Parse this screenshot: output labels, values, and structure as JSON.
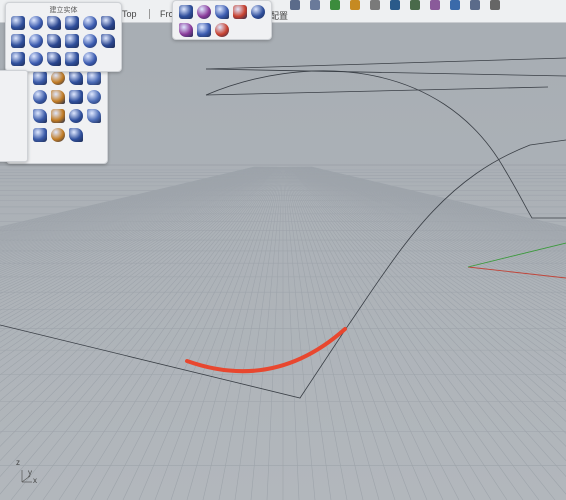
{
  "viewport_tabs": [
    "Top",
    "Fron",
    "配置"
  ],
  "solid_panel": {
    "title": "建立实体"
  },
  "axis_labels": {
    "z": "z",
    "x": "x",
    "y": "y"
  },
  "icons": {
    "solid_panel": [
      "box-icon",
      "cylinder-icon",
      "sphere-icon",
      "ellipsoid-icon",
      "ellipse-solid-icon",
      "cone-icon",
      "cube-icon",
      "pyramid-icon",
      "truncated-cone-icon",
      "cone-small-icon",
      "pyramid-small-icon",
      "tube-icon",
      "pipe-icon",
      "torus-icon",
      "fillet-solid-icon",
      "extrude-solid-icon",
      "boolean-icon"
    ],
    "side_panel": [
      "extrude-icon",
      "color-cube-icon",
      "plane-surface-icon",
      "loft-icon",
      "network-surface-icon",
      "revolve-icon",
      "sweep-icon",
      "blend-surface-icon",
      "edit-points-icon",
      "boolean-union-icon",
      "split-icon",
      "cap-icon",
      "transform-icon",
      "rebuild-icon",
      "edge-icon"
    ],
    "mesh_panel": [
      "mesh-grid-icon",
      "mesh-box-icon",
      "mesh-sphere-icon",
      "mesh-face-icon",
      "point-cloud-icon",
      "mesh-patch-icon",
      "mesh-star-icon",
      "mesh-cube-outline-icon"
    ]
  },
  "colors": {
    "highlight_curve": "#e8472f",
    "grid": "#9ea4ab",
    "x_axis": "#c0453a",
    "y_axis": "#3a9a3a",
    "viewport_bg": "#aeb3b9"
  }
}
